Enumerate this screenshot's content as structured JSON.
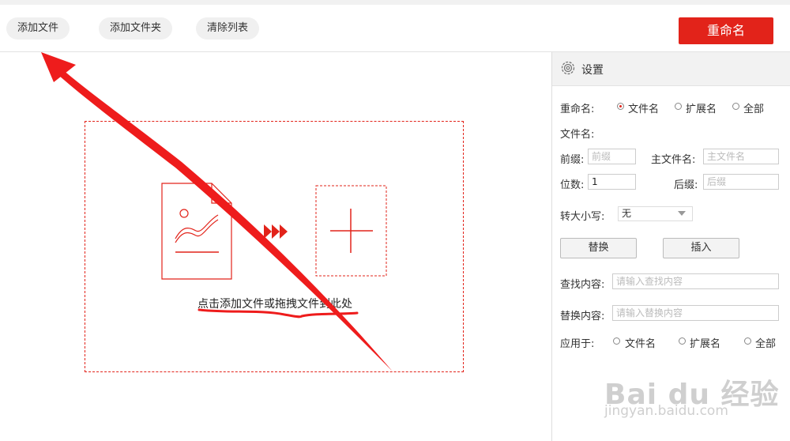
{
  "toolbar": {
    "add_file": "添加文件",
    "add_folder": "添加文件夹",
    "clear_list": "清除列表",
    "rename": "重命名"
  },
  "dropzone": {
    "hint": "点击添加文件或拖拽文件到此处"
  },
  "settings": {
    "title": "设置",
    "rename_label": "重命名:",
    "rename_options": [
      "文件名",
      "扩展名",
      "全部"
    ],
    "rename_selected": "文件名",
    "filename_label": "文件名:",
    "prefix_label": "前缀:",
    "prefix_placeholder": "前缀",
    "main_name_label": "主文件名:",
    "main_name_placeholder": "主文件名",
    "digits_label": "位数:",
    "digits_value": "1",
    "suffix_label": "后缀:",
    "suffix_placeholder": "后缀",
    "case_label": "转大小写:",
    "case_value": "无",
    "replace_button": "替换",
    "insert_button": "插入",
    "find_label": "查找内容:",
    "find_placeholder": "请输入查找内容",
    "replace_label": "替换内容:",
    "replace_placeholder": "请输入替换内容",
    "apply_label": "应用于:",
    "apply_options": [
      "文件名",
      "扩展名",
      "全部"
    ]
  },
  "watermark": {
    "brand": "Bai du 经验",
    "url": "jingyan.baidu.com"
  },
  "colors": {
    "accent": "#e2231a",
    "annotation": "#ee1c1c"
  }
}
